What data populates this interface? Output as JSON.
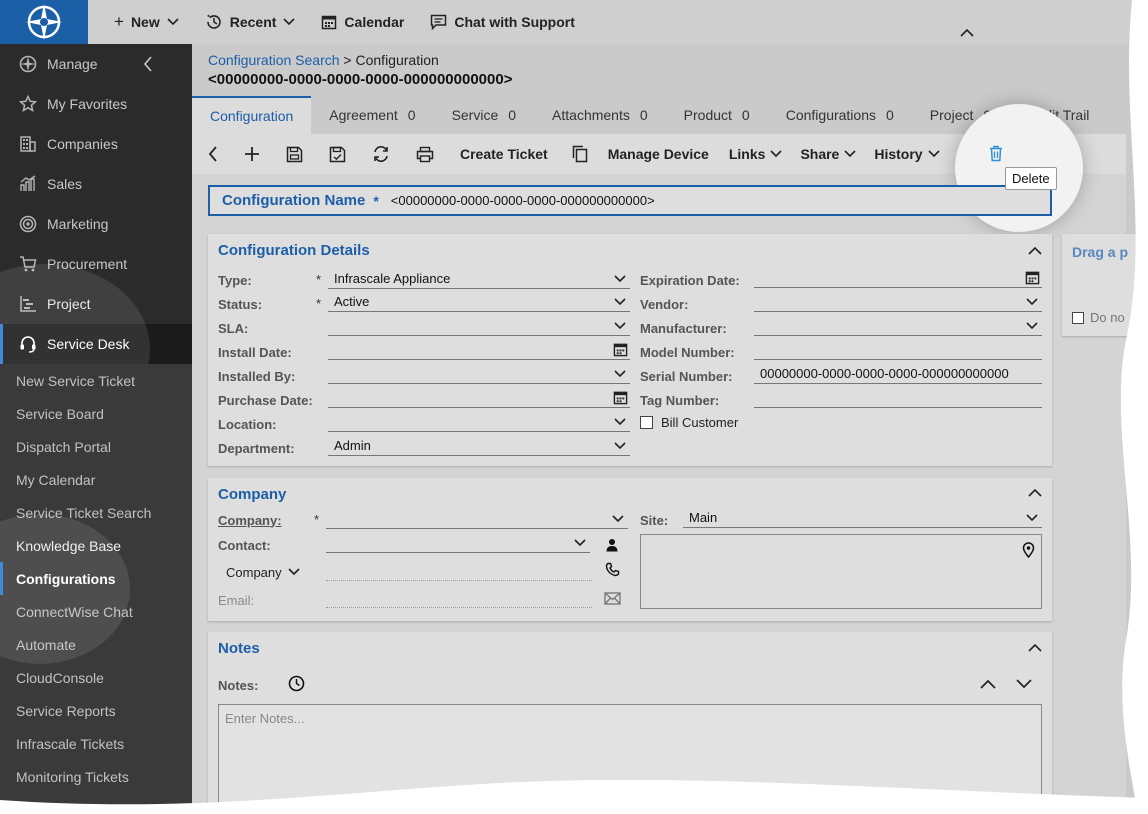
{
  "topbar": {
    "new_label": "New",
    "recent_label": "Recent",
    "calendar_label": "Calendar",
    "chat_label": "Chat with Support"
  },
  "sidebar": {
    "items": [
      {
        "label": "Manage",
        "icon": "manage-icon"
      },
      {
        "label": "My Favorites",
        "icon": "star-icon"
      },
      {
        "label": "Companies",
        "icon": "building-icon"
      },
      {
        "label": "Sales",
        "icon": "chart-icon"
      },
      {
        "label": "Marketing",
        "icon": "target-icon"
      },
      {
        "label": "Procurement",
        "icon": "cart-icon"
      },
      {
        "label": "Project",
        "icon": "gantt-icon"
      },
      {
        "label": "Service Desk",
        "icon": "headset-icon"
      }
    ],
    "subitems": [
      "New Service Ticket",
      "Service Board",
      "Dispatch Portal",
      "My Calendar",
      "Service Ticket Search",
      "Knowledge Base",
      "Configurations",
      "ConnectWise Chat",
      "Automate",
      "CloudConsole",
      "Service Reports",
      "Infrascale Tickets",
      "Monitoring Tickets"
    ],
    "active_item": "Service Desk",
    "active_subitem": "Configurations"
  },
  "breadcrumb": {
    "link": "Configuration Search",
    "separator": ">",
    "current": "Configuration"
  },
  "page_title": "<00000000-0000-0000-0000-000000000000>",
  "tabs": [
    {
      "label": "Configuration",
      "count": ""
    },
    {
      "label": "Agreement",
      "count": "0"
    },
    {
      "label": "Service",
      "count": "0"
    },
    {
      "label": "Attachments",
      "count": "0"
    },
    {
      "label": "Product",
      "count": "0"
    },
    {
      "label": "Configurations",
      "count": "0"
    },
    {
      "label": "Project",
      "count": "0"
    },
    {
      "label": "Audit Trail",
      "count": ""
    }
  ],
  "toolbar": {
    "create_ticket": "Create Ticket",
    "manage_device": "Manage Device",
    "links": "Links",
    "share": "Share",
    "history": "History",
    "delete_tooltip": "Delete"
  },
  "config_name": {
    "label": "Configuration Name",
    "required": "*",
    "value": "<00000000-0000-0000-0000-000000000000>"
  },
  "details": {
    "title": "Configuration Details",
    "type_label": "Type:",
    "type_value": "Infrascale Appliance",
    "status_label": "Status:",
    "status_value": "Active",
    "sla_label": "SLA:",
    "install_date_label": "Install Date:",
    "installed_by_label": "Installed By:",
    "purchase_date_label": "Purchase Date:",
    "location_label": "Location:",
    "department_label": "Department:",
    "department_value": "Admin",
    "expiration_label": "Expiration Date:",
    "vendor_label": "Vendor:",
    "manufacturer_label": "Manufacturer:",
    "model_label": "Model Number:",
    "serial_label": "Serial Number:",
    "serial_value": "00000000-0000-0000-0000-000000000000",
    "tag_label": "Tag Number:",
    "bill_label": "Bill Customer",
    "required": "*"
  },
  "company": {
    "title": "Company",
    "company_label": "Company:",
    "contact_label": "Contact:",
    "company_toggle": "Company",
    "email_label": "Email:",
    "site_label": "Site:",
    "site_value": "Main",
    "required": "*"
  },
  "notes": {
    "title": "Notes",
    "notes_label": "Notes:",
    "placeholder": "Enter Notes..."
  },
  "drag_panel": {
    "title": "Drag a p",
    "checkbox_label": "Do no"
  },
  "colors": {
    "accent": "#1d5ea8",
    "sidebar": "#2b2b2b",
    "logo_bg": "#1b5fa6"
  }
}
